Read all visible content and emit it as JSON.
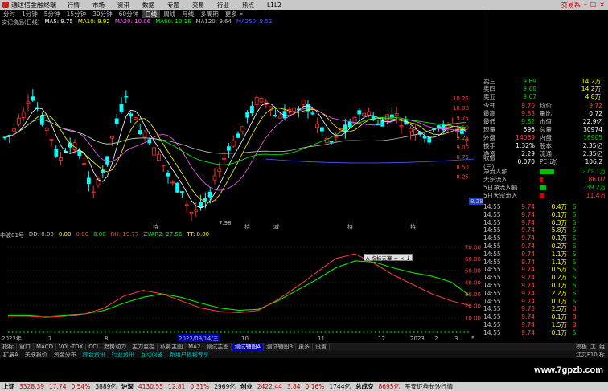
{
  "app": {
    "title": "通达信金融终端",
    "menu": [
      "行情",
      "市场",
      "资讯",
      "数据",
      "专题",
      "交易",
      "行业",
      "热点",
      "L1L2"
    ],
    "right_label": "交易系"
  },
  "periods": {
    "items": [
      "分时",
      "1分钟",
      "5分钟",
      "15分钟",
      "30分钟",
      "60分钟",
      "日线",
      "周线",
      "月线",
      "多周期",
      "更多 >"
    ],
    "active_index": 6
  },
  "ma_legend": [
    {
      "label": "安记食品(日线)",
      "color": "#c0c0c0"
    },
    {
      "label": "MA5: 9.75",
      "color": "#ffffff"
    },
    {
      "label": "MA10: 9.92",
      "color": "#ffff00"
    },
    {
      "label": "MA20: 10.06",
      "color": "#ff60ff"
    },
    {
      "label": "MA60: 10.16",
      "color": "#00ff00"
    },
    {
      "label": "MA120: 9.64",
      "color": "#c0c0c0"
    },
    {
      "label": "MA250: 8.52",
      "color": "#4060ff"
    }
  ],
  "main_axis": {
    "labels": [
      "10.25",
      "10.00",
      "9.75",
      "9.50",
      "9.25",
      "9.00",
      "8.75",
      "8.50",
      "8.25"
    ],
    "current_price_tag": "8.28",
    "low_marker": "7.98"
  },
  "indicator_legend": [
    {
      "label": "中波01号",
      "color": "#c0c0c0"
    },
    {
      "label": "DD: 0.00",
      "color": "#c0c0c0"
    },
    {
      "label": "0.00",
      "color": "#ffff00"
    },
    {
      "label": "0.00",
      "color": "#ff4040"
    },
    {
      "label": "0.00",
      "color": "#00ff00"
    },
    {
      "label": "RH: 19.77",
      "color": "#ff4040"
    },
    {
      "label": "ZVAR2: 27.56",
      "color": "#00ff00"
    },
    {
      "label": "TT: 0.00",
      "color": "#ffff00"
    }
  ],
  "sub_axis": {
    "labels": [
      "70.00",
      "60.00",
      "50.00",
      "40.00",
      "30.00",
      "20.00",
      "10.00"
    ]
  },
  "tooltip": "A 指标五寨 + × ↓",
  "chart_data": [
    {
      "type": "line",
      "title": "",
      "x": [
        1,
        2,
        3,
        4,
        5,
        6,
        7,
        8,
        9,
        10,
        11,
        12,
        13,
        14,
        15,
        16,
        17,
        18,
        19,
        20,
        21,
        22,
        23,
        24,
        25
      ],
      "series": [
        {
          "name": "ZVAR2",
          "color": "#00ff00",
          "values": [
            12,
            12,
            11,
            12,
            13,
            16,
            22,
            27,
            30,
            27,
            22,
            18,
            16,
            17,
            24,
            33,
            42,
            52,
            58,
            57,
            52,
            48,
            45,
            40,
            28
          ]
        },
        {
          "name": "RH",
          "color": "#ff4040",
          "values": [
            11,
            11,
            10,
            11,
            13,
            18,
            28,
            33,
            30,
            24,
            18,
            15,
            14,
            16,
            25,
            36,
            48,
            60,
            64,
            56,
            46,
            38,
            30,
            24,
            20
          ]
        }
      ],
      "ylim": [
        0,
        75
      ]
    }
  ],
  "date_axis": {
    "labels": [
      "2022年",
      "7",
      "8",
      "2022/09/14/三",
      "10",
      "11",
      "12",
      "2023",
      "2",
      "3",
      "5"
    ],
    "tag": "复"
  },
  "signal_labels": [
    "持",
    "持",
    "减",
    "持",
    "持"
  ],
  "right_panel": {
    "asks": [
      {
        "label": "卖三",
        "price": "9.69",
        "vol": "14.2万"
      },
      {
        "label": "卖四",
        "price": "9.68",
        "vol": "14.2万"
      },
      {
        "label": "卖五",
        "price": "9.67",
        "vol": "4.8万"
      }
    ],
    "stats": [
      {
        "l1": "今开",
        "v1": "9.70",
        "l2": "均价",
        "v2": "9.72",
        "c1": "red",
        "c2": "red"
      },
      {
        "l1": "最高",
        "v1": "9.83",
        "l2": "量比",
        "v2": "0.72",
        "c1": "red",
        "c2": "white"
      },
      {
        "l1": "最低",
        "v1": "9.62",
        "l2": "市值",
        "v2": "22.9亿",
        "c1": "green",
        "c2": "white"
      },
      {
        "l1": "现量",
        "v1": "596",
        "l2": "总量",
        "v2": "30974",
        "c1": "white",
        "c2": "white"
      },
      {
        "l1": "外盘",
        "v1": "14069",
        "l2": "内盘",
        "v2": "16905",
        "c1": "red",
        "c2": "green"
      },
      {
        "l1": "换手",
        "v1": "1.32%",
        "l2": "股本",
        "v2": "2.35亿",
        "c1": "white",
        "c2": "white"
      },
      {
        "l1": "净资",
        "v1": "2.29",
        "l2": "流通",
        "v2": "2.35亿",
        "c1": "white",
        "c2": "white"
      },
      {
        "l1": "收益(三)",
        "v1": "0.070",
        "l2": "PE(动)",
        "v2": "106.2",
        "c1": "white",
        "c2": "white"
      }
    ],
    "flows": [
      {
        "label": "净流入额",
        "value": "-271.1万",
        "color": "green",
        "bar": 0.45,
        "barcolor": "#00c000"
      },
      {
        "label": "大宗流入",
        "value": "86.07",
        "color": "red",
        "bar": 0.1,
        "barcolor": "#d00000"
      },
      {
        "label": "5日净流入额",
        "value": "-39.2万",
        "color": "green",
        "bar": 0.2,
        "barcolor": "#00c000"
      },
      {
        "label": "5日大宗流入",
        "value": "11.4万",
        "color": "red",
        "bar": 0.15,
        "barcolor": "#d00000"
      }
    ],
    "ticks": [
      {
        "t": "14:55",
        "p": "9.74",
        "v": "0.4万",
        "d": "S"
      },
      {
        "t": "14:55",
        "p": "9.74",
        "v": "0.1万",
        "d": "S"
      },
      {
        "t": "14:55",
        "p": "9.74",
        "v": "0.3万",
        "d": "S"
      },
      {
        "t": "14:55",
        "p": "9.74",
        "v": "5.8万",
        "d": "S"
      },
      {
        "t": "14:55",
        "p": "9.74",
        "v": "0.1万",
        "d": "S"
      },
      {
        "t": "14:55",
        "p": "9.74",
        "v": "0.2万",
        "d": "S"
      },
      {
        "t": "14:55",
        "p": "9.74",
        "v": "1.1万",
        "d": "S"
      },
      {
        "t": "14:55",
        "p": "9.74",
        "v": "1.1万",
        "d": "S"
      },
      {
        "t": "14:55",
        "p": "9.74",
        "v": "0.5万",
        "d": "S"
      },
      {
        "t": "14:55",
        "p": "9.74",
        "v": "0.2万",
        "d": "S"
      },
      {
        "t": "14:55",
        "p": "9.74",
        "v": "0.1万",
        "d": "S"
      },
      {
        "t": "14:55",
        "p": "9.74",
        "v": "2.2万",
        "d": "S"
      },
      {
        "t": "14:55",
        "p": "9.74",
        "v": "0.1万",
        "d": "S"
      },
      {
        "t": "14:55",
        "p": "9.73",
        "v": "2.5万",
        "d": "B"
      },
      {
        "t": "14:55",
        "p": "9.74",
        "v": "0.1万",
        "d": "B"
      },
      {
        "t": "14:55",
        "p": "9.74",
        "v": "1.5万",
        "d": "B"
      },
      {
        "t": "14:55",
        "p": "9.74",
        "v": "0.1万",
        "d": "S"
      }
    ]
  },
  "tabs_row1": [
    "指标",
    "窗口",
    "MACD",
    "VOL-TDX",
    "CCI",
    "趋势动力",
    "主力监控",
    "私募主图",
    "MA2",
    "测试主图",
    "测试辅图A",
    "测试辅图B",
    "更多",
    "设置"
  ],
  "tabs_row1_active": 10,
  "tabs_row2": [
    "扩展A",
    "关联报价",
    "资金分布",
    "综合资讯",
    "行业资讯",
    "互动问答",
    "新用户福利专享"
  ],
  "right_buttons": [
    "模板",
    "工",
    "组"
  ],
  "footer_right": "江艾F10 标",
  "status": [
    {
      "label": "上证",
      "value": "3328.39",
      "chg": "17.74",
      "pct": "0.54%",
      "amt": "3889亿"
    },
    {
      "label": "沪深",
      "value": "4130.55",
      "chg": "12.81",
      "pct": "0.31%",
      "amt": "2969亿"
    },
    {
      "label": "创业",
      "value": "2422.44",
      "chg": "3.84",
      "pct": "0.16%",
      "amt": "1744亿"
    },
    {
      "label": "总成交",
      "value": "8695亿",
      "chg": "",
      "pct": "",
      "amt": ""
    }
  ],
  "status_tail": "平安证券长沙行情",
  "watermark": "www.7gpzb.com"
}
